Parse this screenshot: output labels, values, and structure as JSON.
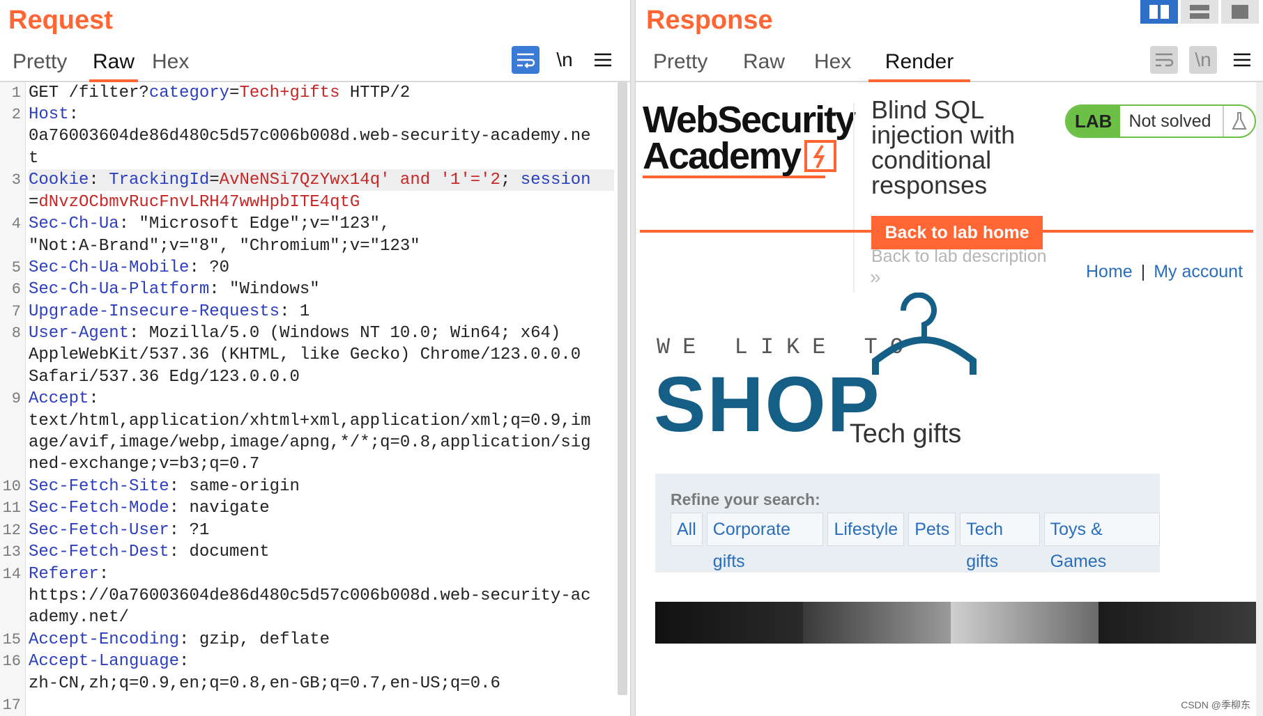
{
  "request": {
    "title": "Request",
    "tabs": [
      "Pretty",
      "Raw",
      "Hex"
    ],
    "active_tab": "Raw",
    "icons": [
      "wrap-lines-icon",
      "newline-icon",
      "menu-icon"
    ],
    "newline_glyph": "\\n",
    "line_numbers": [
      "1",
      "2",
      "3",
      "4",
      "5",
      "6",
      "7",
      "8",
      "9",
      "10",
      "11",
      "12",
      "13",
      "14",
      "15",
      "16",
      "17"
    ]
  },
  "response": {
    "title": "Response",
    "tabs": [
      "Pretty",
      "Raw",
      "Hex",
      "Render"
    ],
    "active_tab": "Render",
    "newline_glyph": "\\n"
  },
  "render": {
    "logo_line1": "WebSecurity",
    "logo_line2": "Academy",
    "lab_title": "Blind SQL injection with conditional responses",
    "lab_badge": "LAB",
    "lab_status": "Not solved",
    "back_home": "Back to lab home",
    "back_description": "Back to lab description",
    "chevron": "»",
    "nav_home": "Home",
    "nav_sep": "|",
    "nav_account": "My account",
    "we_like_to": "WE LIKE TO",
    "shop": "SHOP",
    "category": "Tech gifts",
    "refine_label": "Refine your search:",
    "filters": [
      "All",
      "Corporate gifts",
      "Lifestyle",
      "Pets",
      "Tech gifts",
      "Toys & Games"
    ]
  },
  "watermark": "CSDN @季柳东",
  "colors": {
    "accent": "#ff6633",
    "keyword": "#2b3fbf",
    "value": "#c62828",
    "link": "#2a6ebb",
    "shop_blue": "#155f86",
    "lab_green": "#6cc046"
  }
}
